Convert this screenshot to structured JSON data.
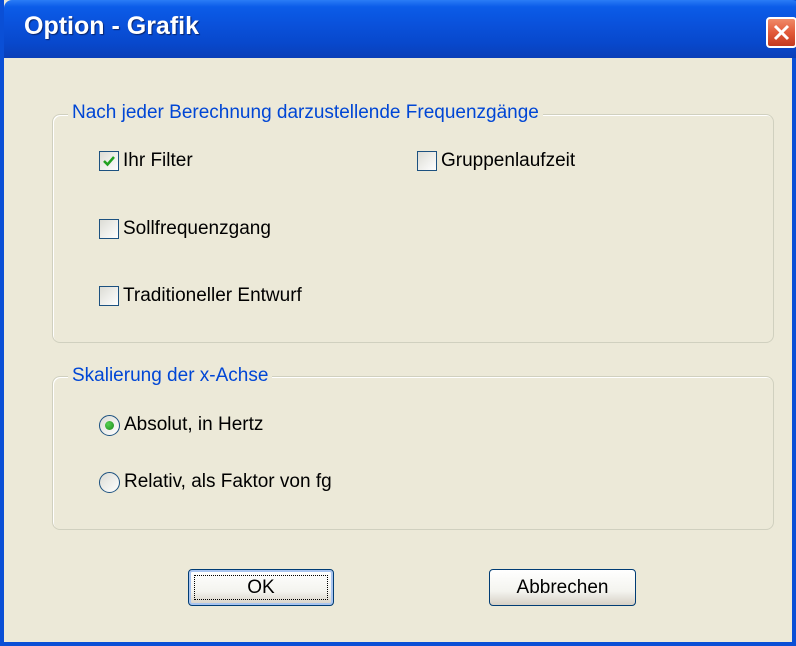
{
  "window": {
    "title": "Option - Grafik"
  },
  "group_curves": {
    "legend": "Nach jeder Berechnung darzustellende Frequenzgänge",
    "checkboxes": [
      {
        "label": "Ihr Filter",
        "checked": true
      },
      {
        "label": "Sollfrequenzgang",
        "checked": false
      },
      {
        "label": "Traditioneller Entwurf",
        "checked": false
      },
      {
        "label": "Gruppenlaufzeit",
        "checked": false
      }
    ]
  },
  "group_scale": {
    "legend": "Skalierung der x-Achse",
    "radios": [
      {
        "label": "Absolut, in Hertz",
        "selected": true
      },
      {
        "label": "Relativ, als Faktor von fg",
        "selected": false
      }
    ]
  },
  "buttons": {
    "ok": "OK",
    "cancel": "Abbrechen"
  },
  "colors": {
    "titlebar": "#0a52dc",
    "legend_text": "#0046d5",
    "dialog_bg": "#ece9d8"
  }
}
